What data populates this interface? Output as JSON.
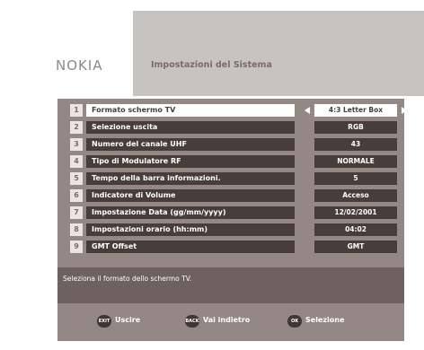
{
  "header": {
    "brand": "NOKIA",
    "title": "Impostazioni del Sistema"
  },
  "menu": [
    {
      "num": "1",
      "label": "Formato schermo TV",
      "value": "4:3 Letter Box",
      "selected": true
    },
    {
      "num": "2",
      "label": "Selezione uscita",
      "value": "RGB"
    },
    {
      "num": "3",
      "label": "Numero del canale UHF",
      "value": "43"
    },
    {
      "num": "4",
      "label": "Tipo di Modulatore RF",
      "value": "NORMALE"
    },
    {
      "num": "5",
      "label": "Tempo della barra informazioni.",
      "value": "5"
    },
    {
      "num": "6",
      "label": "Indicatore di Volume",
      "value": "Acceso"
    },
    {
      "num": "7",
      "label": "Impostazione Data (gg/mm/yyyy)",
      "value": "12/02/2001"
    },
    {
      "num": "8",
      "label": "Impostazioni orario (hh:mm)",
      "value": "04:02"
    },
    {
      "num": "9",
      "label": "GMT Offset",
      "value": "GMT"
    }
  ],
  "help": {
    "text": "Seleziona il formato dello schermo TV."
  },
  "footer": {
    "exit": {
      "badge": "EXIT",
      "label": "Uscire"
    },
    "back": {
      "badge": "BACK",
      "label": "Vai indietro"
    },
    "ok": {
      "badge": "OK",
      "label": "Selezione"
    }
  },
  "colors": {
    "panel": "#948884",
    "title_panel": "#c7c3c1",
    "row_bg": "#473e3c",
    "selected_bg": "#ffffff"
  }
}
